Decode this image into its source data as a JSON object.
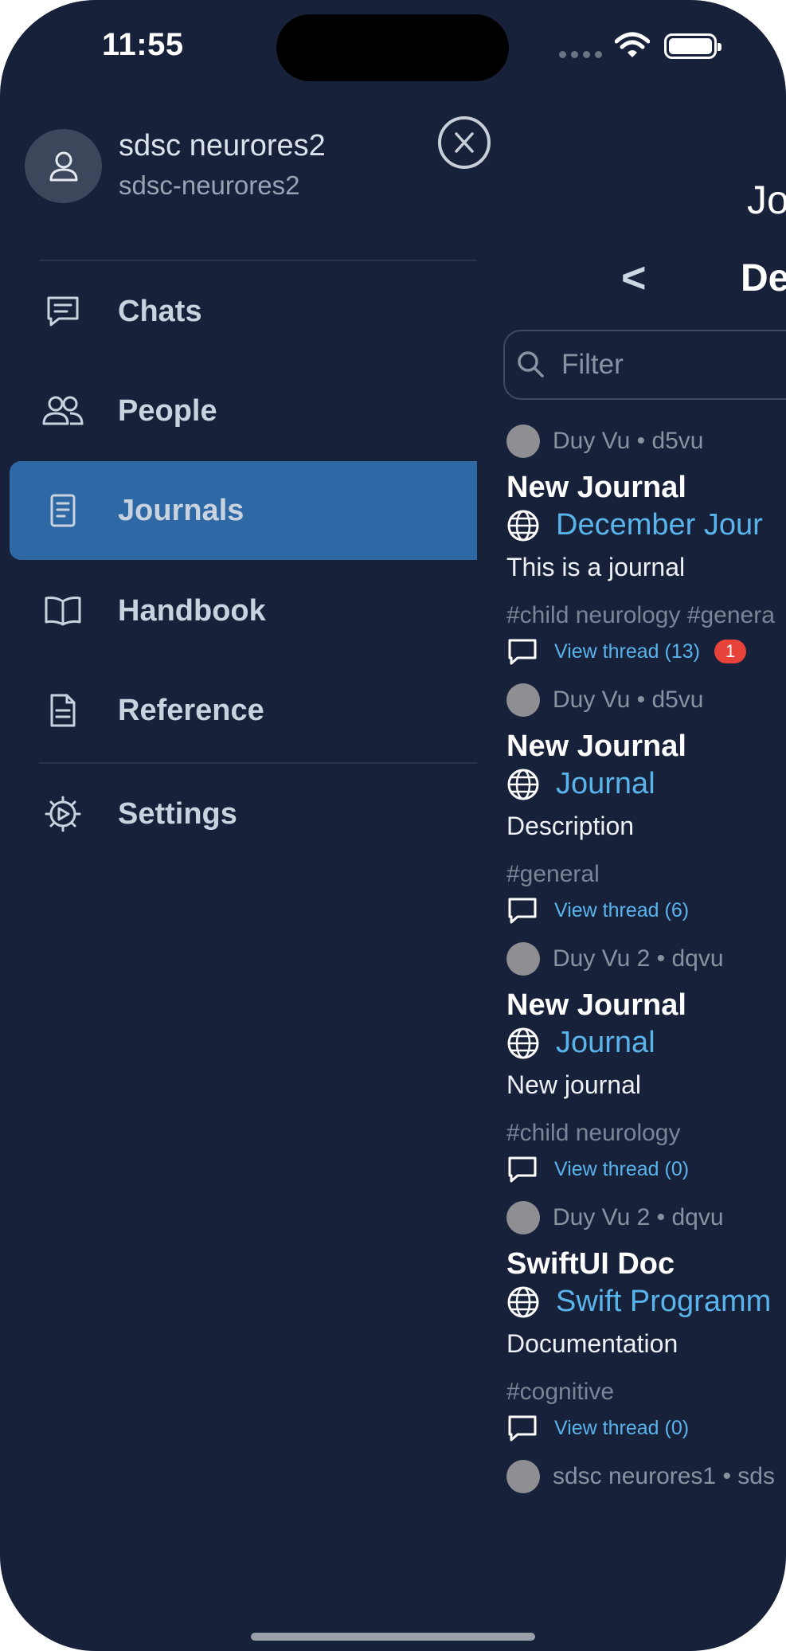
{
  "status": {
    "time": "11:55"
  },
  "user": {
    "name": "sdsc neurores2",
    "handle": "sdsc-neurores2"
  },
  "menu": {
    "items": [
      {
        "label": "Chats",
        "icon": "chat-bubble-icon"
      },
      {
        "label": "People",
        "icon": "people-icon"
      },
      {
        "label": "Journals",
        "icon": "journal-icon",
        "active": true
      },
      {
        "label": "Handbook",
        "icon": "book-icon"
      },
      {
        "label": "Reference",
        "icon": "document-icon"
      },
      {
        "label": "Settings",
        "icon": "gear-icon"
      }
    ]
  },
  "main": {
    "title": "Jo",
    "month": "De",
    "filter_placeholder": "Filter"
  },
  "entries": [
    {
      "author": "Duy Vu  •  d5vu",
      "title": "New Journal",
      "link": "December Jour",
      "desc": "This is a journal",
      "tags": "#child neurology #genera",
      "thread": "View thread (13)",
      "badge": "1"
    },
    {
      "author": "Duy Vu  •  d5vu",
      "title": "New Journal",
      "link": "Journal",
      "desc": "Description",
      "tags": "#general",
      "thread": "View thread (6)"
    },
    {
      "author": "Duy Vu 2  •  dqvu",
      "title": "New Journal",
      "link": "Journal",
      "desc": "New journal",
      "tags": "#child neurology",
      "thread": "View thread (0)"
    },
    {
      "author": "Duy Vu 2  •  dqvu",
      "title": "SwiftUI Doc",
      "link": "Swift Programm",
      "desc": "Documentation",
      "tags": "#cognitive",
      "thread": "View thread (0)"
    },
    {
      "author": "sdsc neurores1  •  sds"
    }
  ],
  "colors": {
    "background": "#172139",
    "accent": "#2e68a5",
    "link": "#5ab4ec",
    "badge": "#e8433b"
  }
}
